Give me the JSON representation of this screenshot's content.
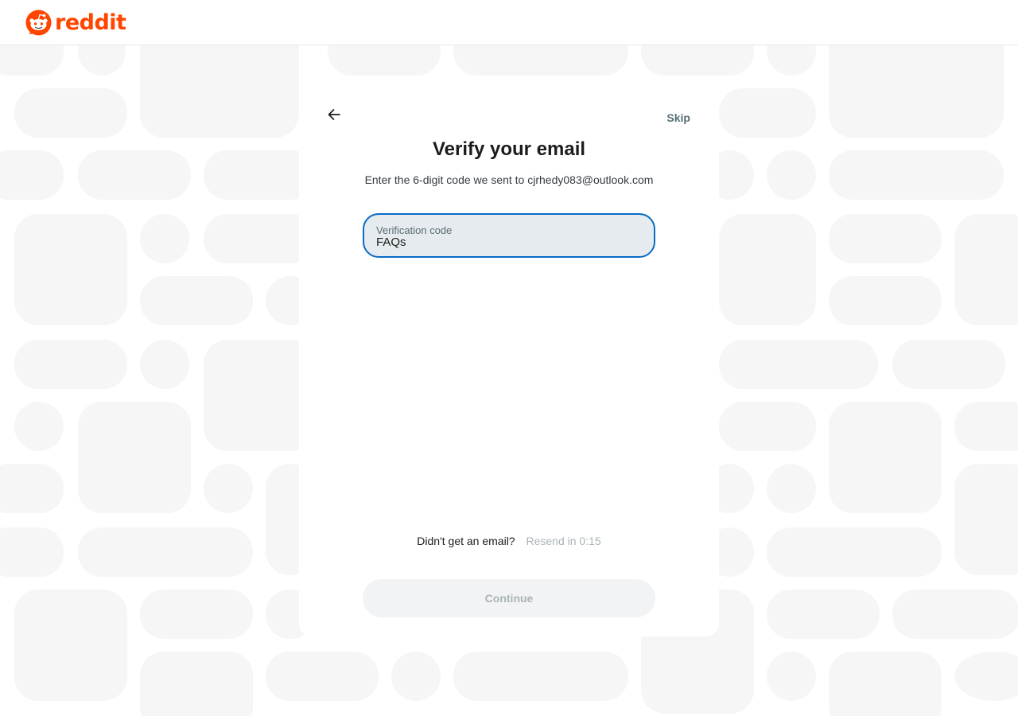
{
  "header": {
    "brand": "reddit",
    "logo_icon": "reddit-snoo-icon",
    "brand_color": "#ff4500"
  },
  "modal": {
    "back_icon": "arrow-left-icon",
    "skip_label": "Skip",
    "title": "Verify your email",
    "subtitle": "Enter the 6-digit code we sent to cjrhedy083@outlook.com",
    "code_field": {
      "label": "Verification code",
      "value": "FAQs",
      "border_color": "#0a6bc5"
    },
    "resend": {
      "question": "Didn't get an email?",
      "timer": "Resend in 0:15"
    },
    "continue_label": "Continue"
  }
}
